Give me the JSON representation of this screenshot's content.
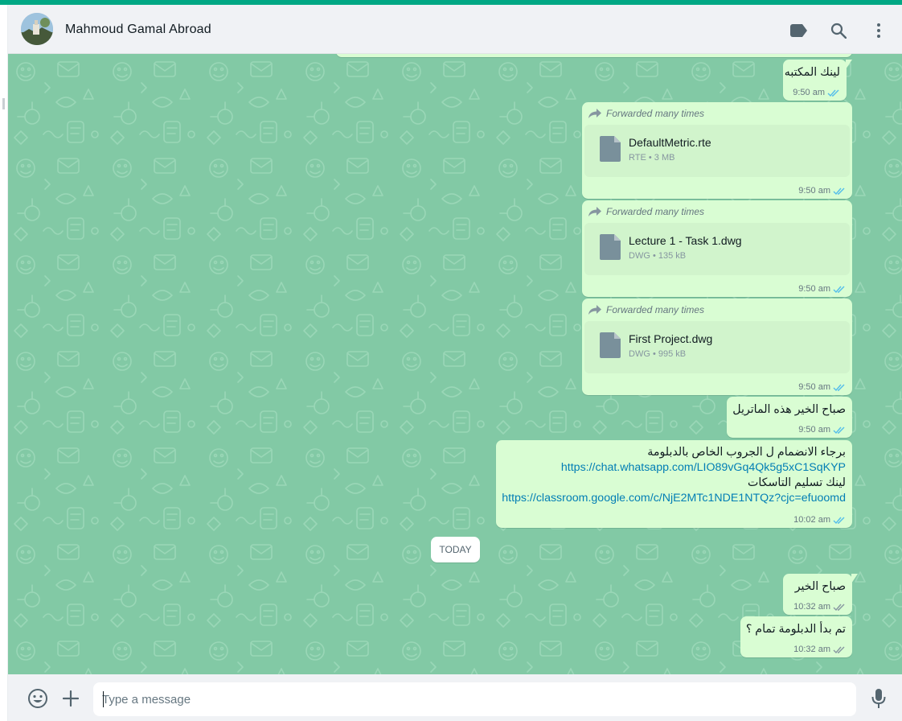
{
  "colors": {
    "accent": "#00a884",
    "chat_bg": "#82c9a5",
    "outgoing": "#d9fdd3",
    "doc_card": "#d1f4cc",
    "link": "#027eb5",
    "read_ticks": "#53bdeb"
  },
  "header": {
    "contact_name": "Mahmoud Gamal Abroad",
    "icons": [
      "label-icon",
      "search-icon",
      "menu-icon"
    ]
  },
  "messages": [
    {
      "kind": "text",
      "text": "لينك المكتبه",
      "time": "9:50 am",
      "status": "read"
    },
    {
      "kind": "document",
      "forwarded_label": "Forwarded many times",
      "file_name": "DefaultMetric.rte",
      "file_info": "RTE • 3 MB",
      "time": "9:50 am",
      "status": "read"
    },
    {
      "kind": "document",
      "forwarded_label": "Forwarded many times",
      "file_name": "Lecture 1 - Task 1.dwg",
      "file_info": "DWG • 135 kB",
      "time": "9:50 am",
      "status": "read"
    },
    {
      "kind": "document",
      "forwarded_label": "Forwarded many times",
      "file_name": "First Project.dwg",
      "file_info": "DWG • 995 kB",
      "time": "9:50 am",
      "status": "read"
    },
    {
      "kind": "text",
      "text": "صباح الخير هذه الماتريل",
      "time": "9:50 am",
      "status": "read"
    },
    {
      "kind": "rich",
      "line1": "برجاء الانضمام ل الجروب الخاص بالدبلومة",
      "link1": "https://chat.whatsapp.com/LIO89vGq4Qk5g5xC1SqKYP",
      "line2": "لينك تسليم التاسكات",
      "link2": "https://classroom.google.com/c/NjE2MTc1NDE1NTQz?cjc=efuoomd",
      "time": "10:02 am",
      "status": "read"
    },
    {
      "kind": "text",
      "text": "صباح الخير",
      "time": "10:32 am",
      "status": "delivered"
    },
    {
      "kind": "text",
      "text": "تم بدأ الدبلومة تمام ؟",
      "time": "10:32 am",
      "status": "delivered"
    }
  ],
  "day_divider": "TODAY",
  "footer": {
    "placeholder": "Type a message",
    "icons": [
      "emoji-icon",
      "attach-plus-icon",
      "microphone-icon"
    ]
  }
}
